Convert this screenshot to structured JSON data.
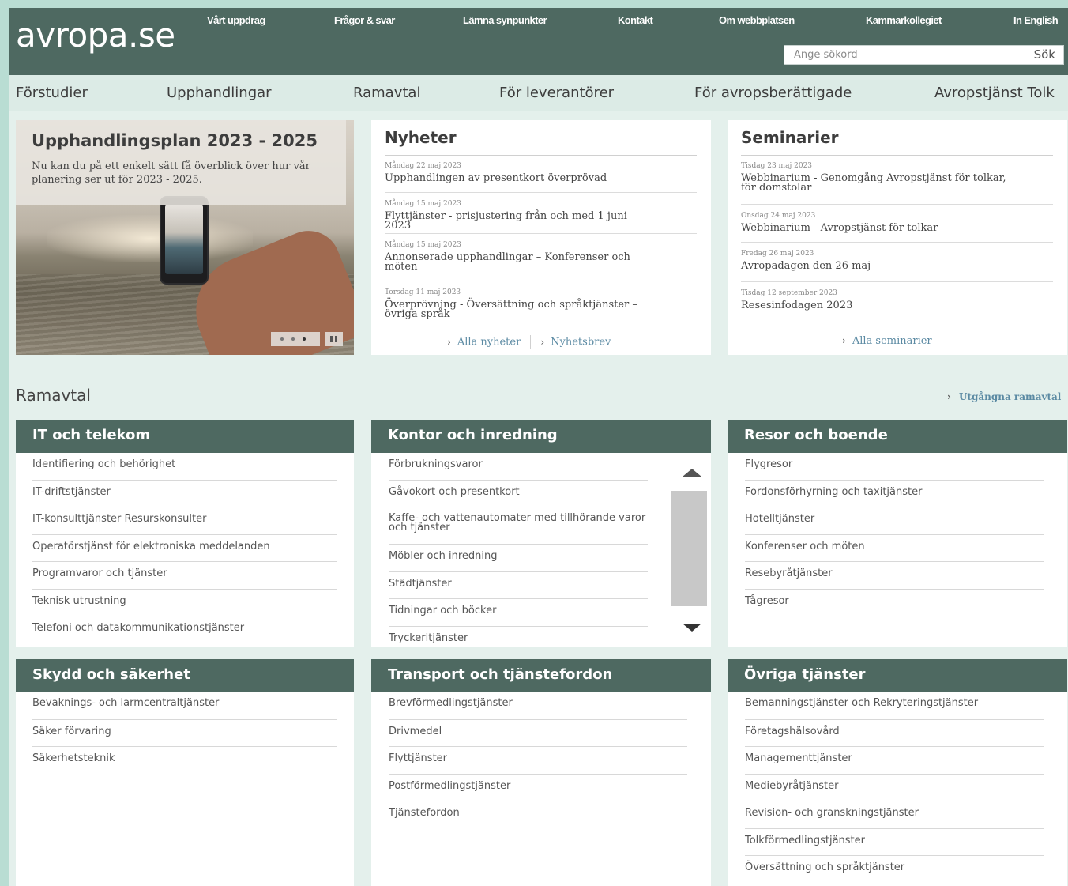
{
  "header": {
    "logo": "avropa.se",
    "util_nav": [
      "Vårt uppdrag",
      "Frågor & svar",
      "Lämna synpunkter",
      "Kontakt",
      "Om webbplatsen",
      "Kammarkollegiet",
      "In English"
    ],
    "search_placeholder": "Ange sökord",
    "search_button": "Sök"
  },
  "main_nav": [
    "Förstudier",
    "Upphandlingar",
    "Ramavtal",
    "För leverantörer",
    "För avropsberättigade",
    "Avropstjänst Tolk"
  ],
  "hero": {
    "title": "Upphandlingsplan 2023 - 2025",
    "text": "Nu kan du på ett enkelt sätt få överblick över hur vår planering ser ut för 2023 - 2025."
  },
  "news": {
    "title": "Nyheter",
    "items": [
      {
        "date": "Måndag 22 maj 2023",
        "title": "Upphandlingen av presentkort överprövad"
      },
      {
        "date": "Måndag 15 maj 2023",
        "title": "Flyttjänster - prisjustering från och med 1 juni 2023"
      },
      {
        "date": "Måndag 15 maj 2023",
        "title": "Annonserade upphandlingar – Konferenser och möten"
      },
      {
        "date": "Torsdag 11 maj 2023",
        "title": "Överprövning - Översättning och språktjänster – övriga språk"
      }
    ],
    "link_all": "Alla nyheter",
    "link_newsletter": "Nyhetsbrev"
  },
  "seminars": {
    "title": "Seminarier",
    "items": [
      {
        "date": "Tisdag 23 maj 2023",
        "title": "Webbinarium - Genomgång Avropstjänst för tolkar, för domstolar"
      },
      {
        "date": "Onsdag 24 maj 2023",
        "title": "Webbinarium - Avropstjänst för tolkar"
      },
      {
        "date": "Fredag 26 maj 2023",
        "title": "Avropadagen den 26 maj"
      },
      {
        "date": "Tisdag 12 september 2023",
        "title": "Resesinfodagen 2023"
      }
    ],
    "link_all": "Alla seminarier"
  },
  "ramavtal": {
    "title": "Ramavtal",
    "expired_link": "Utgångna ramavtal",
    "categories": [
      {
        "title": "IT och telekom",
        "items": [
          "Identifiering och behörighet",
          "IT-driftstjänster",
          "IT-konsulttjänster Resurskonsulter",
          "Operatörstjänst för elektroniska meddelanden",
          "Programvaror och tjänster",
          "Teknisk utrustning",
          "Telefoni och datakommunikationstjänster"
        ]
      },
      {
        "title": "Kontor och inredning",
        "items": [
          "Förbrukningsvaror",
          "Gåvokort och presentkort",
          "Kaffe- och vattenautomater med tillhörande varor och tjänster",
          "Möbler och inredning",
          "Städtjänster",
          "Tidningar och böcker",
          "Tryckeritjänster"
        ]
      },
      {
        "title": "Resor och boende",
        "items": [
          "Flygresor",
          "Fordonsförhyrning och taxitjänster",
          "Hotelltjänster",
          "Konferenser och möten",
          "Resebyråtjänster",
          "Tågresor"
        ]
      },
      {
        "title": "Skydd och säkerhet",
        "items": [
          "Bevaknings- och larmcentraltjänster",
          "Säker förvaring",
          "Säkerhetsteknik"
        ]
      },
      {
        "title": "Transport och tjänstefordon",
        "items": [
          "Brevförmedlingstjänster",
          "Drivmedel",
          "Flyttjänster",
          "Postförmedlingstjänster",
          "Tjänstefordon"
        ]
      },
      {
        "title": "Övriga tjänster",
        "items": [
          "Bemanningstjänster och Rekryteringstjänster",
          "Företagshälsovård",
          "Managementtjänster",
          "Mediebyråtjänster",
          "Revision- och granskningstjänster",
          "Tolkförmedlingstjänster",
          "Översättning och språktjänster"
        ]
      }
    ]
  },
  "colors": {
    "header": "#4e6961",
    "page_bg": "#e4f0ec",
    "link": "#5b8aa3"
  }
}
